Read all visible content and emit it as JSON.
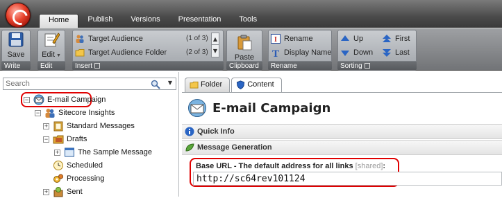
{
  "menu": {
    "tabs": [
      {
        "label": "Home",
        "active": true
      },
      {
        "label": "Publish",
        "active": false
      },
      {
        "label": "Versions",
        "active": false
      },
      {
        "label": "Presentation",
        "active": false
      },
      {
        "label": "Tools",
        "active": false
      }
    ]
  },
  "ribbon": {
    "write": {
      "save_label": "Save",
      "caption": "Write"
    },
    "edit": {
      "edit_label": "Edit",
      "caption": "Edit"
    },
    "insert": {
      "caption": "Insert",
      "items": [
        {
          "label": "Target Audience",
          "count": "(1 of 3)",
          "icon": "users-icon"
        },
        {
          "label": "Target Audience Folder",
          "count": "(2 of 3)",
          "icon": "folder-icon"
        }
      ]
    },
    "clipboard": {
      "paste_label": "Paste",
      "caption": "Clipboard"
    },
    "rename": {
      "caption": "Rename",
      "rename_label": "Rename",
      "display_name_label": "Display Name"
    },
    "sorting": {
      "caption": "Sorting",
      "up": "Up",
      "down": "Down",
      "first": "First",
      "last": "Last"
    }
  },
  "search": {
    "placeholder": "Search"
  },
  "tree": [
    {
      "label": "E-mail Campaign",
      "expander": "−",
      "icon": "email-campaign-icon",
      "highlighted": true
    },
    {
      "label": "Sitecore Insights",
      "expander": "−",
      "icon": "users-icon"
    },
    {
      "label": "Standard Messages",
      "expander": "+",
      "icon": "document-folder-icon"
    },
    {
      "label": "Drafts",
      "expander": "−",
      "icon": "drafts-icon"
    },
    {
      "label": "The Sample Message",
      "expander": "+",
      "icon": "message-icon"
    },
    {
      "label": "Scheduled",
      "expander": "",
      "icon": "clock-icon"
    },
    {
      "label": "Processing",
      "expander": "",
      "icon": "gears-icon"
    },
    {
      "label": "Sent",
      "expander": "+",
      "icon": "sent-icon"
    }
  ],
  "content": {
    "tabs": [
      {
        "label": "Folder",
        "active": false
      },
      {
        "label": "Content",
        "active": true
      }
    ],
    "title": "E-mail Campaign",
    "sections": [
      {
        "label": "Quick Info"
      },
      {
        "label": "Message Generation"
      }
    ],
    "field": {
      "label": "Base URL - The default address for all links",
      "shared": "[shared]",
      "colon": ":",
      "value": "http://sc64rev101124"
    }
  },
  "colors": {
    "highlight_border": "#e00000",
    "ribbon_bg": "#9ea0a3",
    "topbar_bg": "#4b4b4b"
  }
}
